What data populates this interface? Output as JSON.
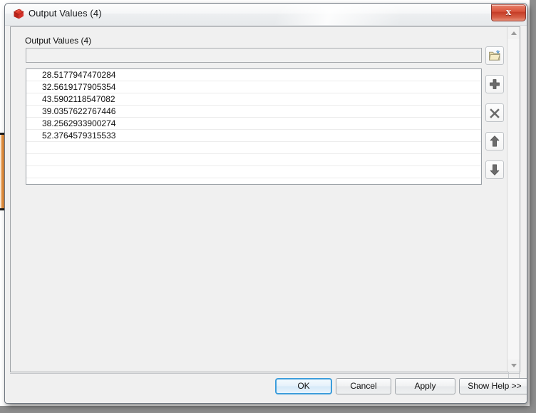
{
  "window": {
    "title": "Output Values (4)",
    "icon": "knime-node-icon",
    "close_label": "x"
  },
  "content": {
    "section_label": "Output Values (4)",
    "name_field": {
      "value": "",
      "placeholder": ""
    },
    "values": [
      "28.5177947470284",
      "32.5619177905354",
      "43.5902118547082",
      "39.0357622767446",
      "38.2562933900274",
      "52.3764579315533"
    ],
    "empty_rows": 3,
    "tools": [
      {
        "name": "browse-folder-button",
        "icon": "folder-add-icon",
        "title": "Browse"
      },
      {
        "name": "add-button",
        "icon": "plus-icon",
        "title": "Add"
      },
      {
        "name": "remove-button",
        "icon": "x-icon",
        "title": "Remove"
      },
      {
        "name": "move-up-button",
        "icon": "arrow-up-icon",
        "title": "Move Up"
      },
      {
        "name": "move-down-button",
        "icon": "arrow-down-icon",
        "title": "Move Down"
      }
    ]
  },
  "buttons": {
    "ok": "OK",
    "cancel": "Cancel",
    "apply": "Apply",
    "help": "Show Help >>"
  },
  "colors": {
    "accent": "#3c9ddb",
    "close_red": "#c53c26",
    "dialog_bg": "#f0f0f0",
    "list_bg": "#ffffff",
    "backdrop_orange": "#d4803a"
  }
}
